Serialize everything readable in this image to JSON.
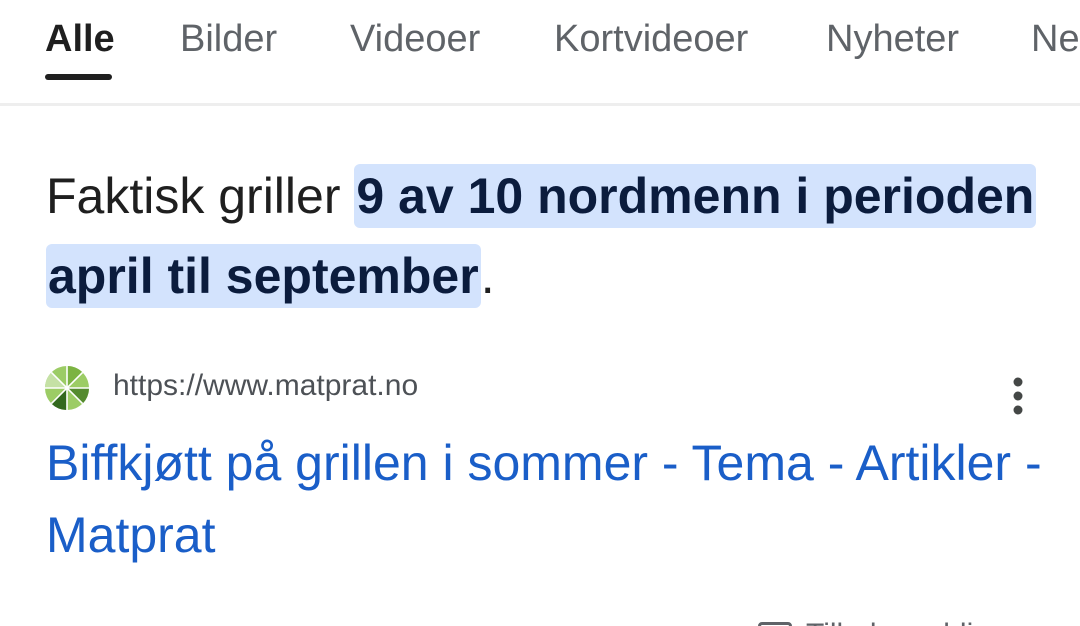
{
  "tabs": [
    {
      "label": "Alle",
      "active": true
    },
    {
      "label": "Bilder",
      "active": false
    },
    {
      "label": "Videoer",
      "active": false
    },
    {
      "label": "Kortvideoer",
      "active": false
    },
    {
      "label": "Nyheter",
      "active": false
    },
    {
      "label": "Ne",
      "active": false
    }
  ],
  "snippet": {
    "prefix": "Faktisk griller ",
    "highlight": "9 av 10 nordmenn i perioden april til september",
    "suffix": "."
  },
  "result": {
    "url": "https://www.matprat.no",
    "title": "Biffkjøtt på grillen i sommer - Tema - Artikler - Matprat",
    "favicon": "matprat-logo-icon"
  },
  "bottom_chip": {
    "label": "Tilbakemelding",
    "icon": "feedback-icon"
  },
  "colors": {
    "highlight_bg": "#d3e3fd",
    "link": "#1a5ec8",
    "tab_inactive": "#5f6368",
    "text": "#1f1f1f"
  }
}
